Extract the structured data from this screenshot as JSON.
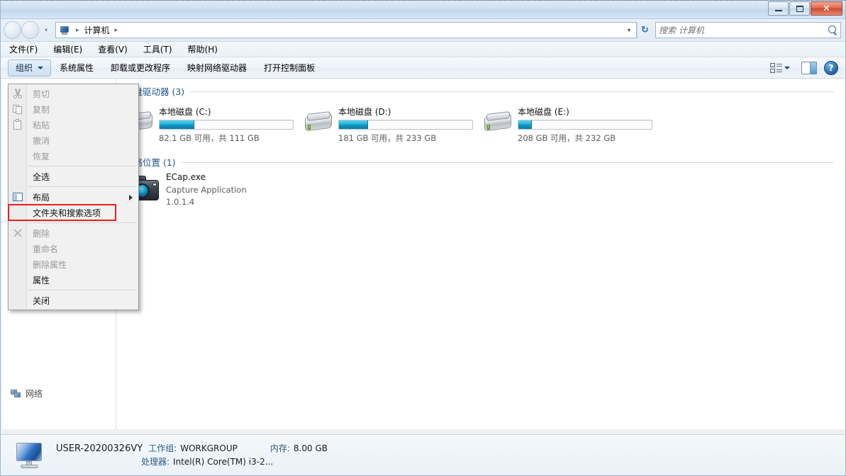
{
  "window": {
    "titlebar": {
      "minimize_label": "最小化",
      "maximize_label": "最大化",
      "close_label": "✕"
    }
  },
  "address": {
    "back_label": "后退",
    "forward_label": "前进",
    "history_label": "▾",
    "crumb_root": "计算机",
    "crumb_sep": "▸",
    "dropdown_label": "▾",
    "refresh_label": "↻",
    "icon": "computer-icon"
  },
  "search": {
    "placeholder": "搜索 计算机",
    "value": "",
    "icon": "search-icon"
  },
  "menubar": {
    "items": [
      {
        "label": "文件(F)"
      },
      {
        "label": "编辑(E)"
      },
      {
        "label": "查看(V)"
      },
      {
        "label": "工具(T)"
      },
      {
        "label": "帮助(H)"
      }
    ]
  },
  "commandbar": {
    "organize_label": "组织",
    "links": [
      {
        "label": "系统属性"
      },
      {
        "label": "卸载或更改程序"
      },
      {
        "label": "映射网络驱动器"
      },
      {
        "label": "打开控制面板"
      }
    ],
    "view_icon": "change-view-icon",
    "view_caret": "▾",
    "preview_icon": "preview-pane-icon",
    "help_label": "?"
  },
  "organize_menu": {
    "items": [
      {
        "label": "剪切",
        "icon": "cut-icon",
        "disabled": true,
        "highlighted": false,
        "submenu": false
      },
      {
        "label": "复制",
        "icon": "copy-icon",
        "disabled": true,
        "highlighted": false,
        "submenu": false
      },
      {
        "label": "粘贴",
        "icon": "paste-icon",
        "disabled": true,
        "highlighted": false,
        "submenu": false
      },
      {
        "label": "撤消",
        "icon": "",
        "disabled": true,
        "highlighted": false,
        "submenu": false
      },
      {
        "label": "恢复",
        "icon": "",
        "disabled": true,
        "highlighted": false,
        "submenu": false
      },
      {
        "separator": true
      },
      {
        "label": "全选",
        "icon": "",
        "disabled": false,
        "highlighted": false,
        "submenu": false
      },
      {
        "separator": true
      },
      {
        "label": "布局",
        "icon": "layout-icon",
        "disabled": false,
        "highlighted": false,
        "submenu": true
      },
      {
        "label": "文件夹和搜索选项",
        "icon": "",
        "disabled": false,
        "highlighted": true,
        "submenu": false
      },
      {
        "separator": true
      },
      {
        "label": "删除",
        "icon": "delete-icon",
        "disabled": true,
        "highlighted": false,
        "submenu": false
      },
      {
        "label": "重命名",
        "icon": "",
        "disabled": true,
        "highlighted": false,
        "submenu": false
      },
      {
        "label": "删除属性",
        "icon": "",
        "disabled": true,
        "highlighted": false,
        "submenu": false
      },
      {
        "label": "属性",
        "icon": "",
        "disabled": false,
        "highlighted": false,
        "submenu": false
      },
      {
        "separator": true
      },
      {
        "label": "关闭",
        "icon": "",
        "disabled": false,
        "highlighted": false,
        "submenu": false
      }
    ],
    "highlight_color": "#ee1c1c"
  },
  "navpane": {
    "ghost_item_label": "网络"
  },
  "groups": [
    {
      "title": "硬盘驱动器 (3)"
    },
    {
      "title": "网络位置 (1)"
    }
  ],
  "drives": [
    {
      "name": "本地磁盘 (C:)",
      "free": "82.1 GB 可用，共 111 GB",
      "used_percent": 26
    },
    {
      "name": "本地磁盘 (D:)",
      "free": "181 GB 可用，共 233 GB",
      "used_percent": 22
    },
    {
      "name": "本地磁盘 (E:)",
      "free": "208 GB 可用，共 232 GB",
      "used_percent": 10
    }
  ],
  "network_items": [
    {
      "name": "ECap.exe",
      "description": "Capture Application",
      "version": "1.0.1.4",
      "icon": "camera-icon"
    }
  ],
  "statusbar": {
    "computer_name": "USER-20200326VY",
    "workgroup_label": "工作组:",
    "workgroup_value": "WORKGROUP",
    "memory_label": "内存:",
    "memory_value": "8.00 GB",
    "processor_label": "处理器:",
    "processor_value": "Intel(R) Core(TM) i3-2...",
    "icon": "computer-monitor-icon"
  }
}
